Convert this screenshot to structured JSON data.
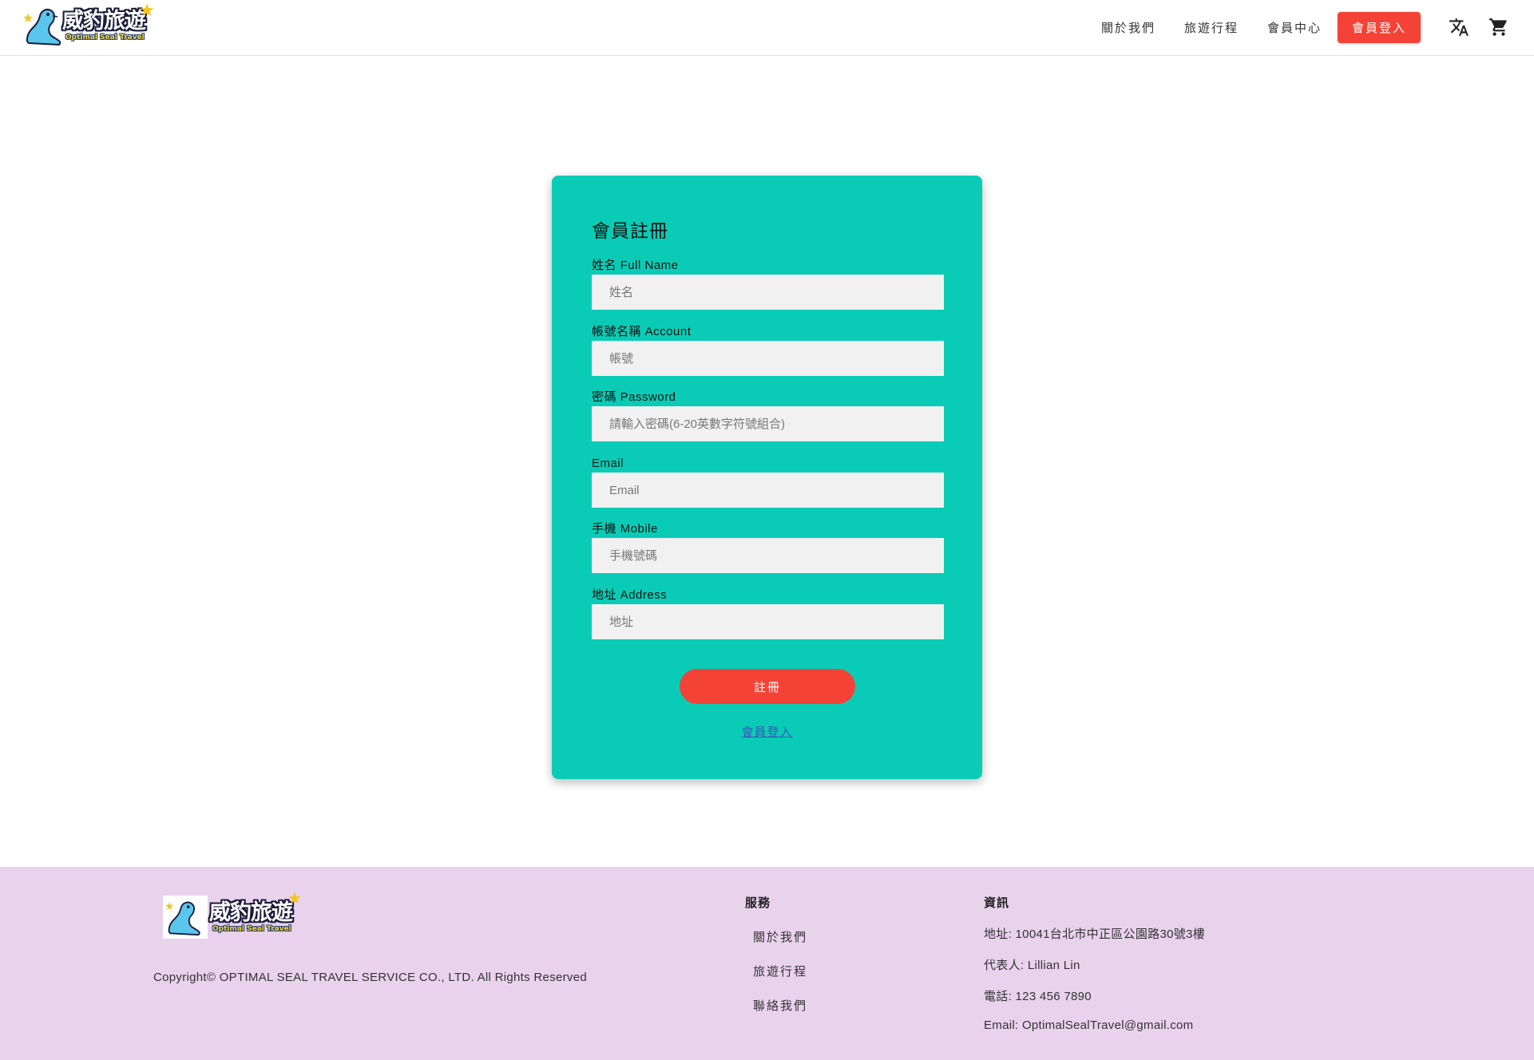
{
  "header": {
    "logo_cn": "威豹旅遊",
    "logo_en": "Optimal Seal Travel",
    "nav": [
      "關於我們",
      "旅遊行程",
      "會員中心"
    ],
    "login_label": "會員登入"
  },
  "form": {
    "title": "會員註冊",
    "fields": [
      {
        "label": "姓名 Full Name",
        "placeholder": "姓名"
      },
      {
        "label": "帳號名稱 Account",
        "placeholder": "帳號"
      },
      {
        "label": "密碼 Password",
        "placeholder": "請輸入密碼(6-20英數字符號組合)"
      },
      {
        "label": "Email",
        "placeholder": "Email"
      },
      {
        "label": "手機 Mobile",
        "placeholder": "手機號碼"
      },
      {
        "label": "地址 Address",
        "placeholder": "地址"
      }
    ],
    "submit_label": "註冊",
    "login_link": "會員登入"
  },
  "footer": {
    "logo_cn": "威豹旅遊",
    "logo_en": "Optimal Seal Travel",
    "copyright": "Copyright© OPTIMAL SEAL TRAVEL SERVICE CO., LTD. All Rights Reserved",
    "services_title": "服務",
    "services": [
      "關於我們",
      "旅遊行程",
      "聯絡我們"
    ],
    "info_title": "資訊",
    "info": [
      "地址: 10041台北市中正區公園路30號3樓",
      "代表人: Lillian Lin",
      "電話: 123 456 7890",
      "Email: OptimalSealTravel@gmail.com"
    ]
  },
  "colors": {
    "accent": "#f44336",
    "card": "#0accb6",
    "footer": "#e8d2ec"
  },
  "icons": [
    "seal-logo-icon",
    "translate-icon",
    "cart-icon"
  ]
}
